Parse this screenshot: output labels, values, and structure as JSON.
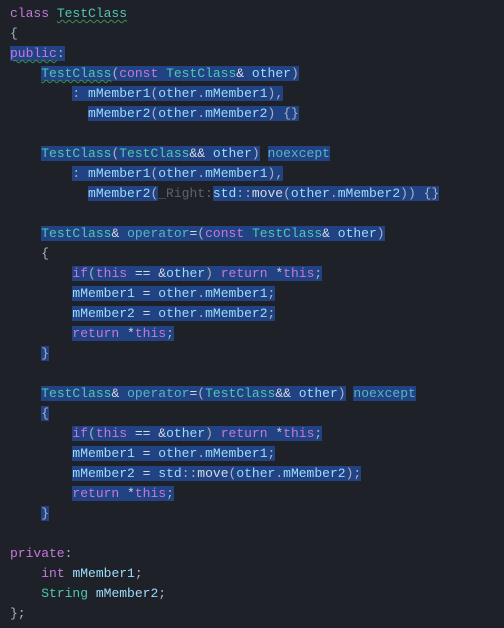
{
  "class_decl": {
    "kw_class": "class",
    "name": "TestClass"
  },
  "open_brace": "{",
  "access_public": "public",
  "colon": ":",
  "copy_ctor": {
    "name": "TestClass",
    "params": {
      "kw_const": "const",
      "type": "TestClass",
      "amp": "&",
      "param": "other"
    },
    "init1": {
      "mem": "mMember1",
      "arg_obj": "other",
      "arg_mem": "mMember1"
    },
    "init2": {
      "mem": "mMember2",
      "arg_obj": "other",
      "arg_mem": "mMember2"
    },
    "body": "{}"
  },
  "move_ctor": {
    "name": "TestClass",
    "params": {
      "type": "TestClass",
      "amp": "&&",
      "param": "other"
    },
    "noexcept": "noexcept",
    "init1": {
      "mem": "mMember1",
      "arg_obj": "other",
      "arg_mem": "mMember1"
    },
    "init2": {
      "mem": "mMember2",
      "hint": "_Right:",
      "ns": "std",
      "move": "move",
      "arg_obj": "other",
      "arg_mem": "mMember2"
    },
    "body": "{}"
  },
  "copy_assign": {
    "ret": "TestClass",
    "amp": "&",
    "op_kw": "operator",
    "eq": "=",
    "params": {
      "kw_const": "const",
      "type": "TestClass",
      "amp": "&",
      "param": "other"
    },
    "open": "{",
    "l1": {
      "kw_if": "if",
      "kw_this": "this",
      "eqop": "==",
      "amp": "&",
      "other": "other",
      "kw_return": "return",
      "star": "*",
      "kw_this2": "this"
    },
    "l2": {
      "lhs": "mMember1",
      "eq": "=",
      "obj": "other",
      "rhs": "mMember1"
    },
    "l3": {
      "lhs": "mMember2",
      "eq": "=",
      "obj": "other",
      "rhs": "mMember2"
    },
    "l4": {
      "kw_return": "return",
      "star": "*",
      "kw_this": "this"
    },
    "close": "}"
  },
  "move_assign": {
    "ret": "TestClass",
    "amp": "&",
    "op_kw": "operator",
    "eq": "=",
    "params": {
      "type": "TestClass",
      "amp": "&&",
      "param": "other"
    },
    "noexcept": "noexcept",
    "open": "{",
    "l1": {
      "kw_if": "if",
      "kw_this": "this",
      "eqop": "==",
      "amp": "&",
      "other": "other",
      "kw_return": "return",
      "star": "*",
      "kw_this2": "this"
    },
    "l2": {
      "lhs": "mMember1",
      "eq": "=",
      "obj": "other",
      "rhs": "mMember1"
    },
    "l3": {
      "lhs": "mMember2",
      "eq": "=",
      "ns": "std",
      "move": "move",
      "obj": "other",
      "rhs": "mMember2"
    },
    "l4": {
      "kw_return": "return",
      "star": "*",
      "kw_this": "this"
    },
    "close": "}"
  },
  "access_private": "private",
  "mem1": {
    "type": "int",
    "name": "mMember1"
  },
  "mem2": {
    "type": "String",
    "name": "mMember2"
  },
  "close_brace": "};"
}
